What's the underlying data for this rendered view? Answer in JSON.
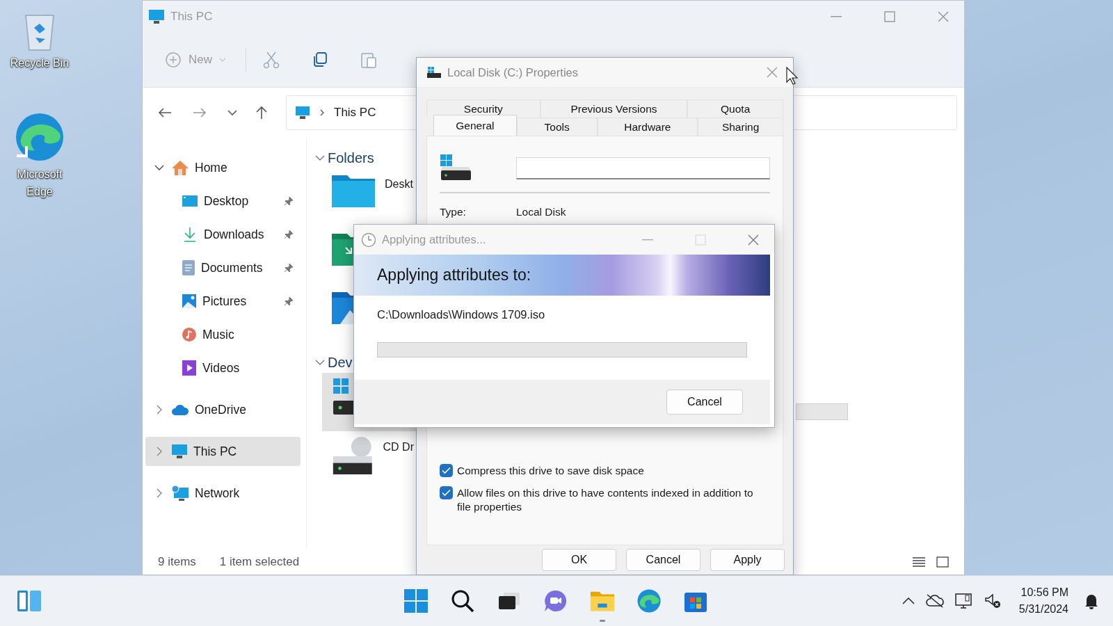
{
  "desktop_icons": [
    {
      "kind": "recycle-bin",
      "label": "Recycle Bin"
    },
    {
      "kind": "edge",
      "label": "Microsoft Edge"
    }
  ],
  "explorer": {
    "title": "This PC",
    "new_label": "New",
    "address": "This PC",
    "nav": [
      {
        "kind": "home",
        "label": "Home",
        "expanded": true,
        "selected": false,
        "children": [
          {
            "kind": "desktop",
            "label": "Desktop",
            "pinned": true,
            "selected": false
          },
          {
            "kind": "downloads",
            "label": "Downloads",
            "pinned": true,
            "selected": false
          },
          {
            "kind": "documents",
            "label": "Documents",
            "pinned": true,
            "selected": false
          },
          {
            "kind": "pictures",
            "label": "Pictures",
            "pinned": true,
            "selected": false
          },
          {
            "kind": "music",
            "label": "Music",
            "pinned": false,
            "selected": false
          },
          {
            "kind": "videos",
            "label": "Videos",
            "pinned": false,
            "selected": false
          }
        ]
      },
      {
        "kind": "onedrive",
        "label": "OneDrive",
        "expanded": false,
        "selected": false
      },
      {
        "kind": "pc",
        "label": "This PC",
        "expanded": false,
        "selected": true
      },
      {
        "kind": "network",
        "label": "Network",
        "expanded": false,
        "selected": false
      }
    ],
    "sections": [
      {
        "title": "Folders",
        "expanded": true,
        "items": [
          {
            "kind": "desktop-folder",
            "label": "Deskt",
            "selected": false
          },
          {
            "kind": "downloads-folder",
            "selected": false
          },
          {
            "kind": "pictures-folder",
            "selected": false
          }
        ]
      },
      {
        "title": "Dev",
        "expanded": true,
        "items": [
          {
            "kind": "system-drive",
            "selected": true
          },
          {
            "kind": "cd-drive",
            "label": "CD Dr",
            "selected": false
          }
        ]
      }
    ],
    "status": [
      "9 items",
      "1 item selected"
    ]
  },
  "properties": {
    "title": "Local Disk (C:) Properties",
    "tab_rows": [
      [
        {
          "label": "Security",
          "selected": false
        },
        {
          "label": "Previous Versions",
          "selected": false
        },
        {
          "label": "Quota",
          "selected": false
        }
      ],
      [
        {
          "label": "General",
          "selected": true
        },
        {
          "label": "Tools",
          "selected": false
        },
        {
          "label": "Hardware",
          "selected": false
        },
        {
          "label": "Sharing",
          "selected": false
        }
      ]
    ],
    "type_label": "Type:",
    "type_value": "Local Disk",
    "checkboxes": [
      {
        "label": "Compress this drive to save disk space",
        "checked": true
      },
      {
        "label": "Allow files on this drive to have contents indexed in addition to file properties",
        "checked": true
      }
    ],
    "buttons": [
      "OK",
      "Cancel",
      "Apply"
    ]
  },
  "progress": {
    "title": "Applying attributes...",
    "heading": "Applying attributes to:",
    "path": "C:\\Downloads\\Windows 1709.iso",
    "button": "Cancel"
  },
  "taskbar": {
    "apps": [
      {
        "kind": "start",
        "active": false
      },
      {
        "kind": "search",
        "active": false
      },
      {
        "kind": "task-view",
        "active": false
      },
      {
        "kind": "chat",
        "active": false
      },
      {
        "kind": "explorer",
        "active": true
      },
      {
        "kind": "edge",
        "active": false
      },
      {
        "kind": "store",
        "active": false
      }
    ],
    "tray": [
      {
        "kind": "chevron"
      },
      {
        "kind": "cloud-off"
      },
      {
        "kind": "network"
      },
      {
        "kind": "volume-muted"
      }
    ],
    "time": "10:56 PM",
    "date": "5/31/2024"
  }
}
